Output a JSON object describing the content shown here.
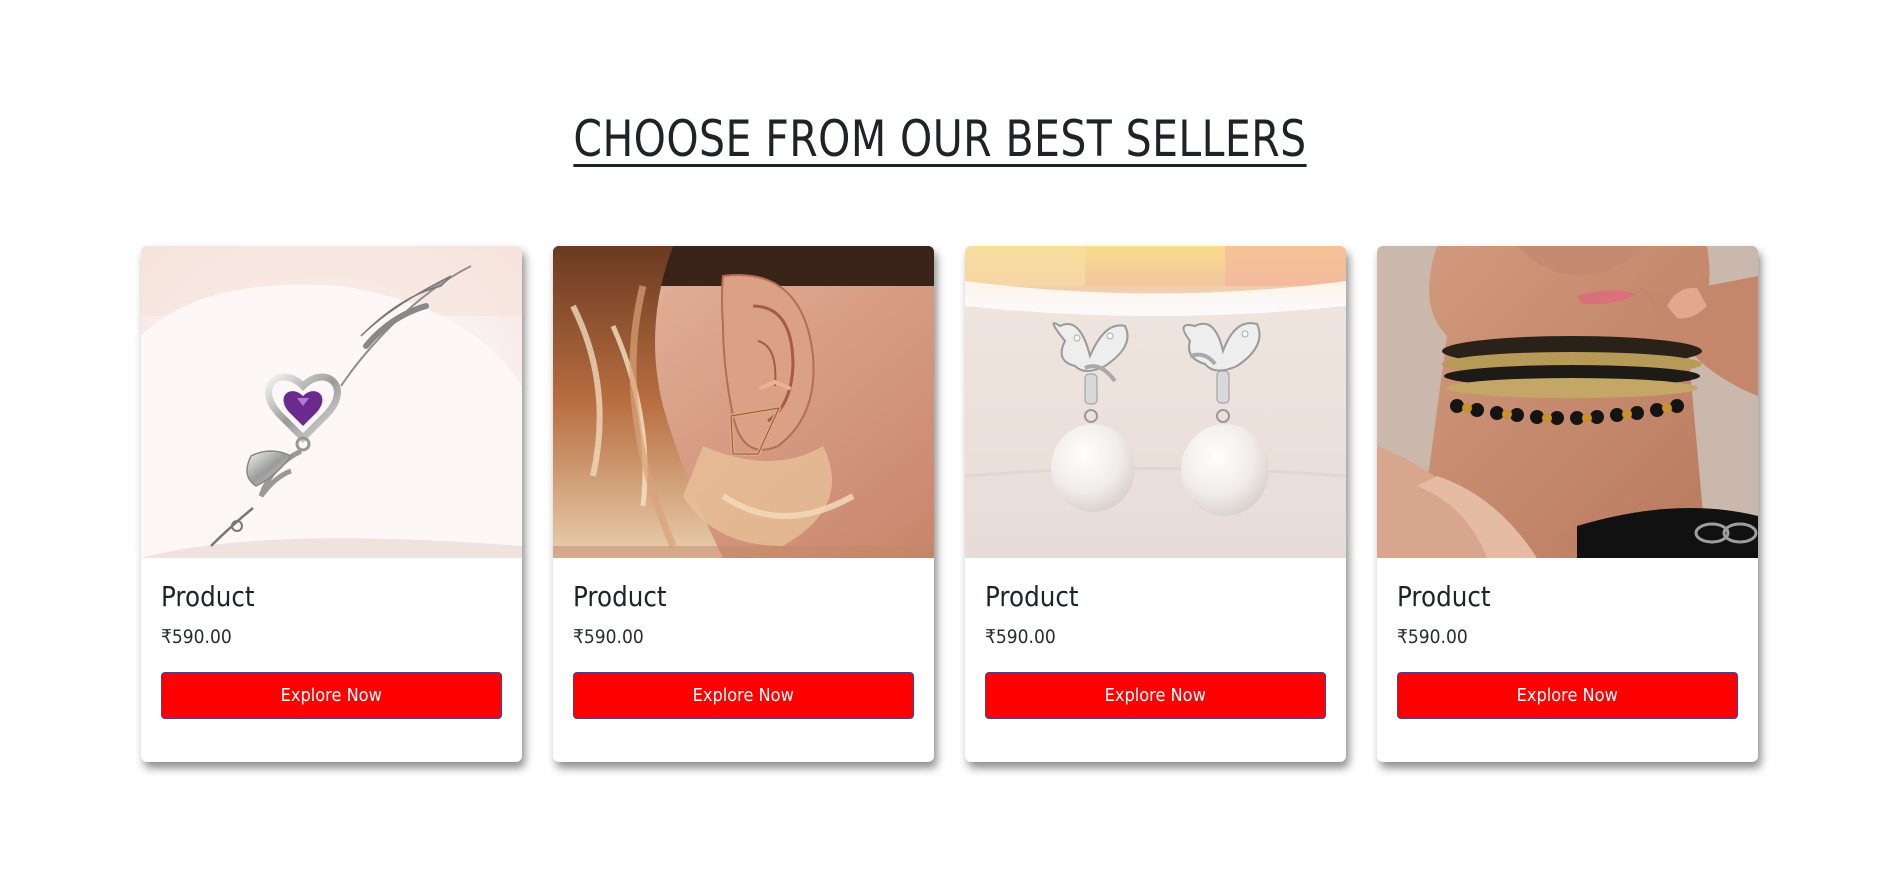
{
  "section": {
    "title": "CHOOSE FROM OUR BEST SELLERS"
  },
  "products": [
    {
      "name": "Product",
      "price": "₹590.00",
      "button_label": "Explore Now",
      "image_icon": "heart-bracelet-image"
    },
    {
      "name": "Product",
      "price": "₹590.00",
      "button_label": "Explore Now",
      "image_icon": "ear-jacket-earring-image"
    },
    {
      "name": "Product",
      "price": "₹590.00",
      "button_label": "Explore Now",
      "image_icon": "butterfly-pearl-earrings-image"
    },
    {
      "name": "Product",
      "price": "₹590.00",
      "button_label": "Explore Now",
      "image_icon": "beaded-choker-image"
    }
  ],
  "colors": {
    "button_bg": "#ff0000",
    "button_border": "#4b3f8f",
    "title_text": "#1f2328"
  }
}
